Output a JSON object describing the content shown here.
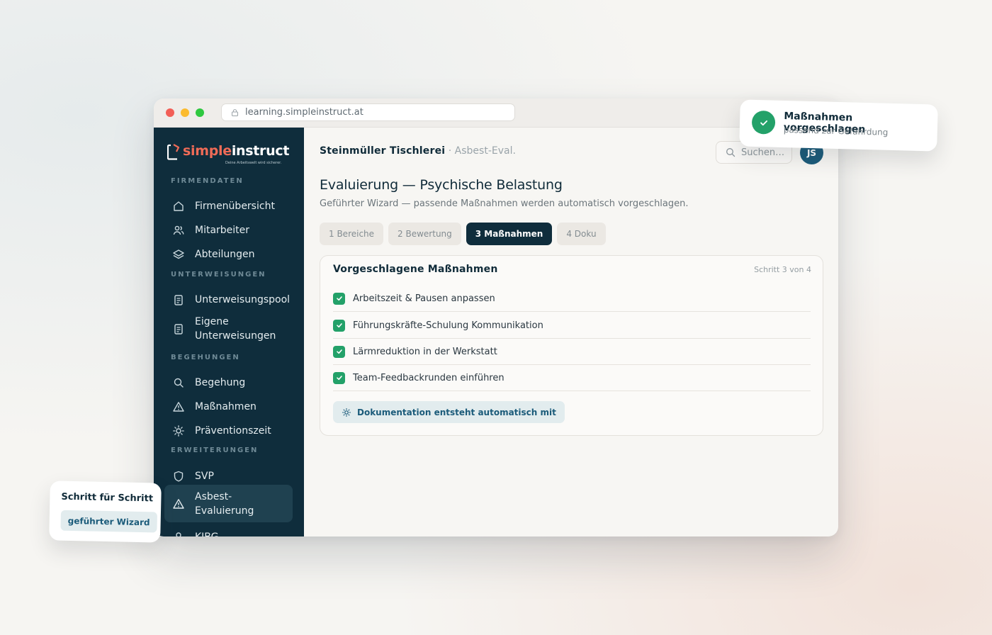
{
  "browser": {
    "url": "learning.simpleinstruct.at"
  },
  "brand": {
    "name_part1": "simple",
    "name_part2": "instruct",
    "tagline": "Deine Arbeitswelt wird sicherer.",
    "accent": "#ef6b57",
    "sidebar_bg": "#0f2d3c"
  },
  "sidebar": {
    "sections": [
      {
        "label": "FIRMENDATEN"
      },
      {
        "label": "UNTERWEISUNGEN"
      },
      {
        "label": "BEGEHUNGEN"
      },
      {
        "label": "ERWEITERUNGEN"
      }
    ],
    "items": [
      {
        "label": "Firmenübersicht",
        "icon": "home-icon"
      },
      {
        "label": "Mitarbeiter",
        "icon": "users-icon"
      },
      {
        "label": "Abteilungen",
        "icon": "layers-icon"
      },
      {
        "label": "Unterweisungspool",
        "icon": "clipboard-icon"
      },
      {
        "label": "Eigene Unterweisungen",
        "icon": "clipboard-icon"
      },
      {
        "label": "Begehung",
        "icon": "search-icon"
      },
      {
        "label": "Maßnahmen",
        "icon": "warning-icon"
      },
      {
        "label": "Präventionszeit",
        "icon": "sun-icon"
      },
      {
        "label": "SVP",
        "icon": "shield-icon"
      },
      {
        "label": "Asbest-Evaluierung",
        "icon": "warning-icon",
        "active": true
      },
      {
        "label": "KJBG",
        "icon": "user-icon"
      }
    ]
  },
  "header": {
    "company": "Steinmüller Tischlerei",
    "context": "· Asbest-Eval.",
    "search_placeholder": "Suchen…",
    "avatar_initials": "JS"
  },
  "page": {
    "title": "Evaluierung — Psychische Belastung",
    "subtitle": "Geführter Wizard — passende Maßnahmen werden automatisch vorgeschlagen."
  },
  "steps": [
    {
      "label": "1 Bereiche"
    },
    {
      "label": "2 Bewertung"
    },
    {
      "label": "3 Maßnahmen",
      "active": true
    },
    {
      "label": "4 Doku"
    }
  ],
  "card": {
    "title": "Vorgeschlagene Maßnahmen",
    "step_indicator": "Schritt 3 von 4",
    "measures": [
      {
        "label": "Arbeitszeit & Pausen anpassen",
        "checked": true
      },
      {
        "label": "Führungskräfte-Schulung Kommunikation",
        "checked": true
      },
      {
        "label": "Lärmreduktion in der Werkstatt",
        "checked": true
      },
      {
        "label": "Team-Feedbackrunden einführen",
        "checked": true
      }
    ],
    "doc_note": "Dokumentation entsteht automatisch mit"
  },
  "toast": {
    "title": "Maßnahmen vorgeschlagen",
    "subtitle": "passend zur Gefährdung"
  },
  "hint": {
    "title": "Schritt für Schritt",
    "chip": "geführter Wizard"
  },
  "colors": {
    "success": "#23a169",
    "primary_dark": "#0f2d3c",
    "link_blue": "#1b5b7a"
  }
}
